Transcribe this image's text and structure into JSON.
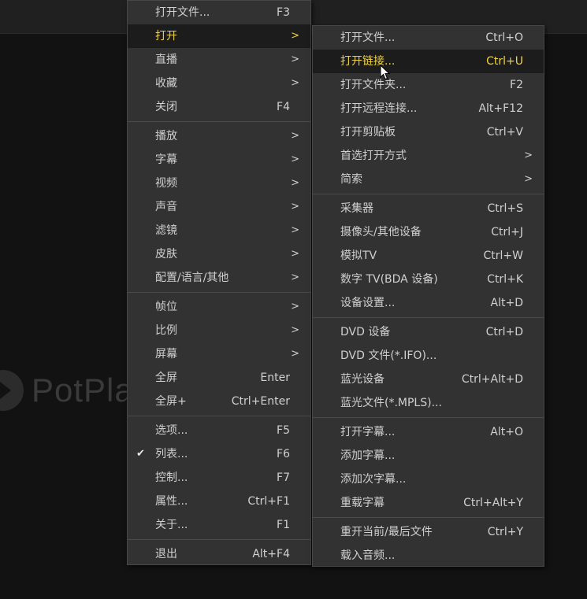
{
  "watermark": {
    "text": "PotPlay"
  },
  "main_menu": {
    "groups": [
      [
        {
          "label": "打开文件...",
          "shortcut": "F3",
          "submenu": false,
          "active": false
        },
        {
          "label": "打开",
          "shortcut": "",
          "submenu": true,
          "active": true
        },
        {
          "label": "直播",
          "shortcut": "",
          "submenu": true,
          "active": false
        },
        {
          "label": "收藏",
          "shortcut": "",
          "submenu": true,
          "active": false
        },
        {
          "label": "关闭",
          "shortcut": "F4",
          "submenu": false,
          "active": false
        }
      ],
      [
        {
          "label": "播放",
          "shortcut": "",
          "submenu": true,
          "active": false
        },
        {
          "label": "字幕",
          "shortcut": "",
          "submenu": true,
          "active": false
        },
        {
          "label": "视频",
          "shortcut": "",
          "submenu": true,
          "active": false
        },
        {
          "label": "声音",
          "shortcut": "",
          "submenu": true,
          "active": false
        },
        {
          "label": "滤镜",
          "shortcut": "",
          "submenu": true,
          "active": false
        },
        {
          "label": "皮肤",
          "shortcut": "",
          "submenu": true,
          "active": false
        },
        {
          "label": "配置/语言/其他",
          "shortcut": "",
          "submenu": true,
          "active": false
        }
      ],
      [
        {
          "label": "帧位",
          "shortcut": "",
          "submenu": true,
          "active": false
        },
        {
          "label": "比例",
          "shortcut": "",
          "submenu": true,
          "active": false
        },
        {
          "label": "屏幕",
          "shortcut": "",
          "submenu": true,
          "active": false
        },
        {
          "label": "全屏",
          "shortcut": "Enter",
          "submenu": false,
          "active": false
        },
        {
          "label": "全屏+",
          "shortcut": "Ctrl+Enter",
          "submenu": false,
          "active": false
        }
      ],
      [
        {
          "label": "选项...",
          "shortcut": "F5",
          "submenu": false,
          "active": false
        },
        {
          "label": "列表...",
          "shortcut": "F6",
          "submenu": false,
          "active": false,
          "checked": true
        },
        {
          "label": "控制...",
          "shortcut": "F7",
          "submenu": false,
          "active": false
        },
        {
          "label": "属性...",
          "shortcut": "Ctrl+F1",
          "submenu": false,
          "active": false
        },
        {
          "label": "关于...",
          "shortcut": "F1",
          "submenu": false,
          "active": false
        }
      ],
      [
        {
          "label": "退出",
          "shortcut": "Alt+F4",
          "submenu": false,
          "active": false
        }
      ]
    ]
  },
  "open_submenu": {
    "groups": [
      [
        {
          "label": "打开文件...",
          "shortcut": "Ctrl+O",
          "submenu": false,
          "active": false
        },
        {
          "label": "打开链接...",
          "shortcut": "Ctrl+U",
          "submenu": false,
          "active": true
        },
        {
          "label": "打开文件夹...",
          "shortcut": "F2",
          "submenu": false,
          "active": false
        },
        {
          "label": "打开远程连接...",
          "shortcut": "Alt+F12",
          "submenu": false,
          "active": false
        },
        {
          "label": "打开剪贴板",
          "shortcut": "Ctrl+V",
          "submenu": false,
          "active": false
        },
        {
          "label": "首选打开方式",
          "shortcut": "",
          "submenu": true,
          "active": false
        },
        {
          "label": "简索",
          "shortcut": "",
          "submenu": true,
          "active": false
        }
      ],
      [
        {
          "label": "采集器",
          "shortcut": "Ctrl+S",
          "submenu": false,
          "active": false
        },
        {
          "label": "摄像头/其他设备",
          "shortcut": "Ctrl+J",
          "submenu": false,
          "active": false
        },
        {
          "label": "模拟TV",
          "shortcut": "Ctrl+W",
          "submenu": false,
          "active": false
        },
        {
          "label": "数字 TV(BDA 设备)",
          "shortcut": "Ctrl+K",
          "submenu": false,
          "active": false
        },
        {
          "label": "设备设置...",
          "shortcut": "Alt+D",
          "submenu": false,
          "active": false
        }
      ],
      [
        {
          "label": "DVD 设备",
          "shortcut": "Ctrl+D",
          "submenu": false,
          "active": false
        },
        {
          "label": "DVD 文件(*.IFO)...",
          "shortcut": "",
          "submenu": false,
          "active": false
        },
        {
          "label": "蓝光设备",
          "shortcut": "Ctrl+Alt+D",
          "submenu": false,
          "active": false
        },
        {
          "label": "蓝光文件(*.MPLS)...",
          "shortcut": "",
          "submenu": false,
          "active": false
        }
      ],
      [
        {
          "label": "打开字幕...",
          "shortcut": "Alt+O",
          "submenu": false,
          "active": false
        },
        {
          "label": "添加字幕...",
          "shortcut": "",
          "submenu": false,
          "active": false
        },
        {
          "label": "添加次字幕...",
          "shortcut": "",
          "submenu": false,
          "active": false
        },
        {
          "label": "重载字幕",
          "shortcut": "Ctrl+Alt+Y",
          "submenu": false,
          "active": false
        }
      ],
      [
        {
          "label": "重开当前/最后文件",
          "shortcut": "Ctrl+Y",
          "submenu": false,
          "active": false
        },
        {
          "label": "载入音频...",
          "shortcut": "",
          "submenu": false,
          "active": false
        }
      ]
    ]
  },
  "submenu_arrow": ">",
  "check_glyph": "✔",
  "colors": {
    "menu_bg": "#323232",
    "active_bg": "#1c1c1c",
    "active_text": "#f0d23a",
    "text": "#d0d0d0"
  }
}
